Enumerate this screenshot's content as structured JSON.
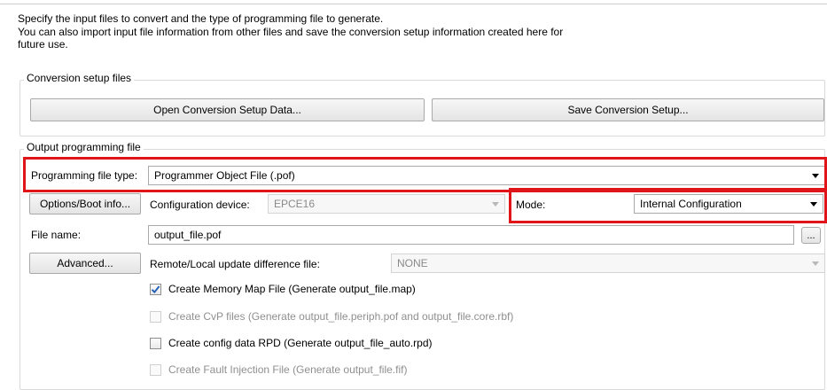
{
  "intro": {
    "line1": "Specify the input files to convert and the type of programming file to generate.",
    "line2": "You can also import input file information from other files and save the conversion setup information created here for",
    "line3": "future use."
  },
  "conversion_setup": {
    "title": "Conversion setup files",
    "open_label": "Open Conversion Setup Data...",
    "save_label": "Save Conversion Setup..."
  },
  "output": {
    "title": "Output programming file",
    "file_type_label": "Programming file type:",
    "file_type_value": "Programmer Object File (.pof)",
    "options_label": "Options/Boot info...",
    "config_device_label": "Configuration device:",
    "config_device_value": "EPCE16",
    "mode_label": "Mode:",
    "mode_value": "Internal Configuration",
    "file_name_label": "File name:",
    "file_name_value": "output_file.pof",
    "browse_label": "...",
    "advanced_label": "Advanced...",
    "remote_label": "Remote/Local update difference file:",
    "remote_value": "NONE"
  },
  "checks": [
    {
      "label": "Create Memory Map File (Generate output_file.map)",
      "checked": true,
      "enabled": true
    },
    {
      "label": "Create CvP files (Generate output_file.periph.pof and output_file.core.rbf)",
      "checked": false,
      "enabled": false
    },
    {
      "label": "Create config data RPD (Generate output_file_auto.rpd)",
      "checked": false,
      "enabled": true
    },
    {
      "label": "Create Fault Injection File (Generate output_file.fif)",
      "checked": false,
      "enabled": false
    }
  ],
  "colors": {
    "highlight": "#e0151a",
    "check_mark": "#1f5fb5"
  }
}
